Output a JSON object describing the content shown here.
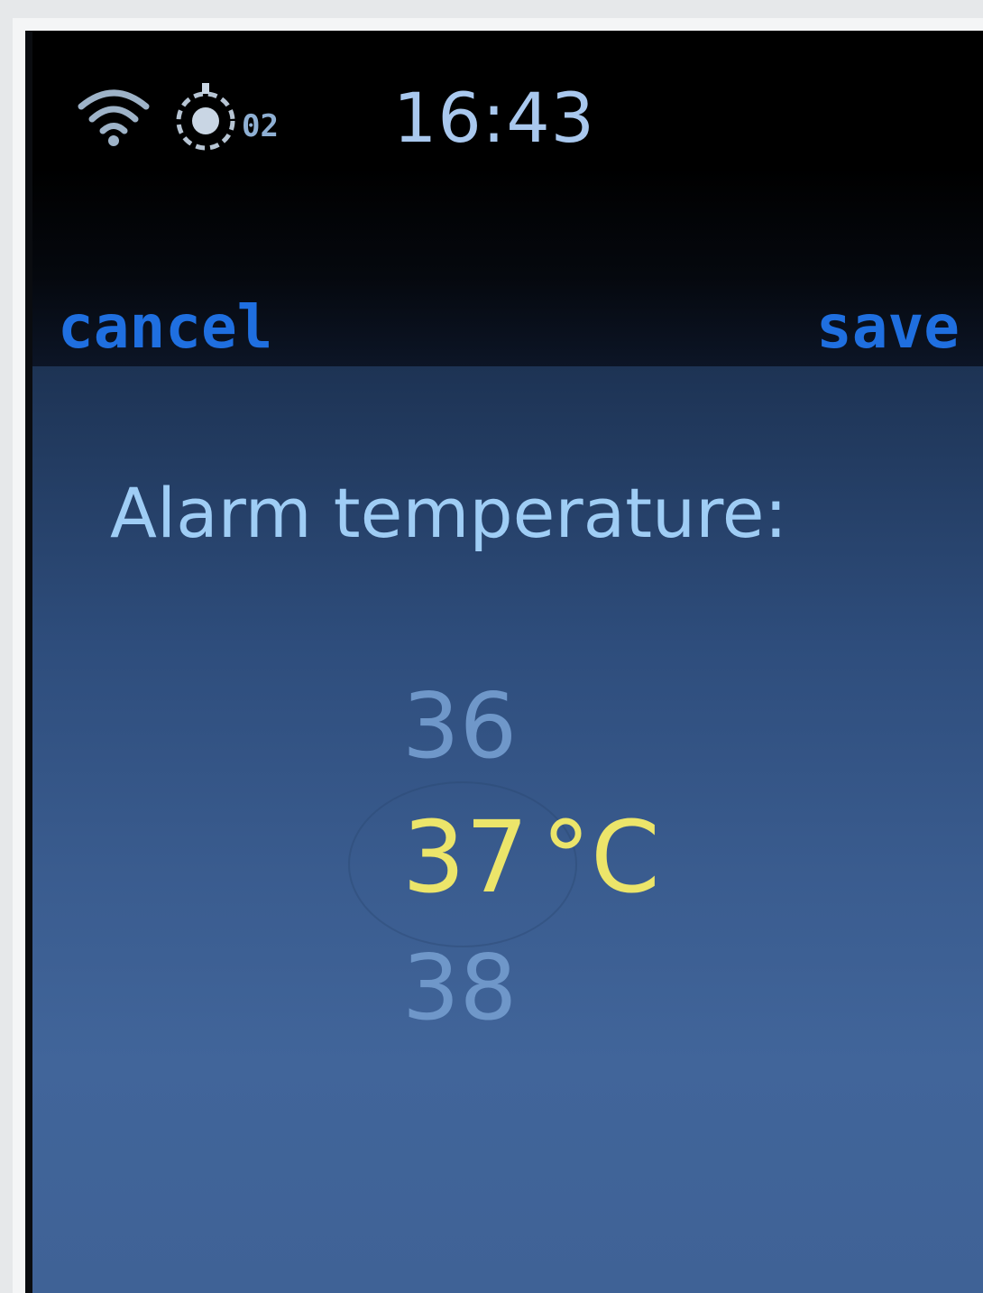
{
  "status": {
    "wifi_icon": "wifi-icon",
    "oxygen_icon": "oxygen-sensor-icon",
    "oxygen_label": "02",
    "time": "16:43"
  },
  "actions": {
    "cancel_label": "cancel",
    "save_label": "save"
  },
  "setting": {
    "title": "Alarm temperature:",
    "previous_value": "36",
    "current_value": "37",
    "unit": "°C",
    "next_value": "38"
  },
  "colors": {
    "action": "#1f6fe0",
    "title": "#9fcdf5",
    "selected_value": "#ece56a",
    "adjacent_value": "#6f97c9",
    "time": "#a9c8ee"
  }
}
